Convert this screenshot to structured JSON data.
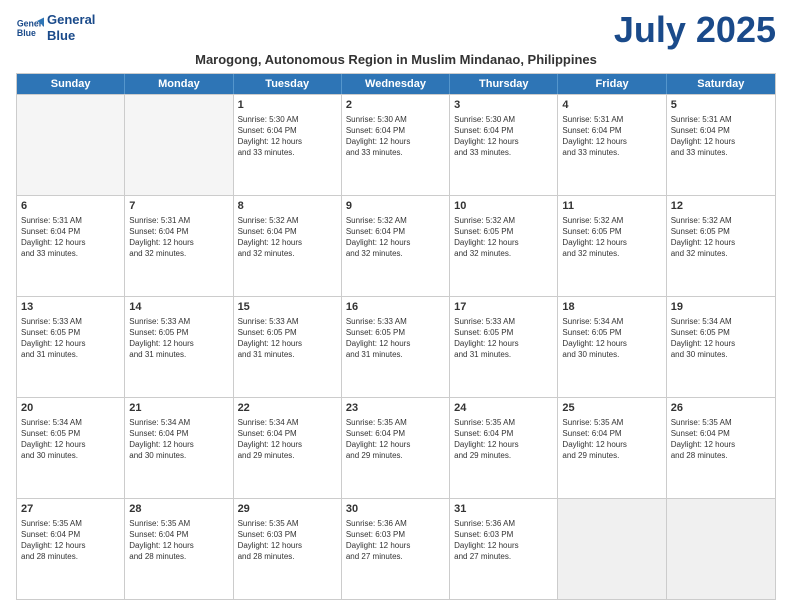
{
  "header": {
    "logo_line1": "General",
    "logo_line2": "Blue",
    "month": "July 2025",
    "subtitle": "Marogong, Autonomous Region in Muslim Mindanao, Philippines"
  },
  "weekdays": [
    "Sunday",
    "Monday",
    "Tuesday",
    "Wednesday",
    "Thursday",
    "Friday",
    "Saturday"
  ],
  "rows": [
    [
      {
        "day": "",
        "info": "",
        "empty": true
      },
      {
        "day": "",
        "info": "",
        "empty": true
      },
      {
        "day": "1",
        "info": "Sunrise: 5:30 AM\nSunset: 6:04 PM\nDaylight: 12 hours\nand 33 minutes."
      },
      {
        "day": "2",
        "info": "Sunrise: 5:30 AM\nSunset: 6:04 PM\nDaylight: 12 hours\nand 33 minutes."
      },
      {
        "day": "3",
        "info": "Sunrise: 5:30 AM\nSunset: 6:04 PM\nDaylight: 12 hours\nand 33 minutes."
      },
      {
        "day": "4",
        "info": "Sunrise: 5:31 AM\nSunset: 6:04 PM\nDaylight: 12 hours\nand 33 minutes."
      },
      {
        "day": "5",
        "info": "Sunrise: 5:31 AM\nSunset: 6:04 PM\nDaylight: 12 hours\nand 33 minutes."
      }
    ],
    [
      {
        "day": "6",
        "info": "Sunrise: 5:31 AM\nSunset: 6:04 PM\nDaylight: 12 hours\nand 33 minutes."
      },
      {
        "day": "7",
        "info": "Sunrise: 5:31 AM\nSunset: 6:04 PM\nDaylight: 12 hours\nand 32 minutes."
      },
      {
        "day": "8",
        "info": "Sunrise: 5:32 AM\nSunset: 6:04 PM\nDaylight: 12 hours\nand 32 minutes."
      },
      {
        "day": "9",
        "info": "Sunrise: 5:32 AM\nSunset: 6:04 PM\nDaylight: 12 hours\nand 32 minutes."
      },
      {
        "day": "10",
        "info": "Sunrise: 5:32 AM\nSunset: 6:05 PM\nDaylight: 12 hours\nand 32 minutes."
      },
      {
        "day": "11",
        "info": "Sunrise: 5:32 AM\nSunset: 6:05 PM\nDaylight: 12 hours\nand 32 minutes."
      },
      {
        "day": "12",
        "info": "Sunrise: 5:32 AM\nSunset: 6:05 PM\nDaylight: 12 hours\nand 32 minutes."
      }
    ],
    [
      {
        "day": "13",
        "info": "Sunrise: 5:33 AM\nSunset: 6:05 PM\nDaylight: 12 hours\nand 31 minutes."
      },
      {
        "day": "14",
        "info": "Sunrise: 5:33 AM\nSunset: 6:05 PM\nDaylight: 12 hours\nand 31 minutes."
      },
      {
        "day": "15",
        "info": "Sunrise: 5:33 AM\nSunset: 6:05 PM\nDaylight: 12 hours\nand 31 minutes."
      },
      {
        "day": "16",
        "info": "Sunrise: 5:33 AM\nSunset: 6:05 PM\nDaylight: 12 hours\nand 31 minutes."
      },
      {
        "day": "17",
        "info": "Sunrise: 5:33 AM\nSunset: 6:05 PM\nDaylight: 12 hours\nand 31 minutes."
      },
      {
        "day": "18",
        "info": "Sunrise: 5:34 AM\nSunset: 6:05 PM\nDaylight: 12 hours\nand 30 minutes."
      },
      {
        "day": "19",
        "info": "Sunrise: 5:34 AM\nSunset: 6:05 PM\nDaylight: 12 hours\nand 30 minutes."
      }
    ],
    [
      {
        "day": "20",
        "info": "Sunrise: 5:34 AM\nSunset: 6:05 PM\nDaylight: 12 hours\nand 30 minutes."
      },
      {
        "day": "21",
        "info": "Sunrise: 5:34 AM\nSunset: 6:04 PM\nDaylight: 12 hours\nand 30 minutes."
      },
      {
        "day": "22",
        "info": "Sunrise: 5:34 AM\nSunset: 6:04 PM\nDaylight: 12 hours\nand 29 minutes."
      },
      {
        "day": "23",
        "info": "Sunrise: 5:35 AM\nSunset: 6:04 PM\nDaylight: 12 hours\nand 29 minutes."
      },
      {
        "day": "24",
        "info": "Sunrise: 5:35 AM\nSunset: 6:04 PM\nDaylight: 12 hours\nand 29 minutes."
      },
      {
        "day": "25",
        "info": "Sunrise: 5:35 AM\nSunset: 6:04 PM\nDaylight: 12 hours\nand 29 minutes."
      },
      {
        "day": "26",
        "info": "Sunrise: 5:35 AM\nSunset: 6:04 PM\nDaylight: 12 hours\nand 28 minutes."
      }
    ],
    [
      {
        "day": "27",
        "info": "Sunrise: 5:35 AM\nSunset: 6:04 PM\nDaylight: 12 hours\nand 28 minutes."
      },
      {
        "day": "28",
        "info": "Sunrise: 5:35 AM\nSunset: 6:04 PM\nDaylight: 12 hours\nand 28 minutes."
      },
      {
        "day": "29",
        "info": "Sunrise: 5:35 AM\nSunset: 6:03 PM\nDaylight: 12 hours\nand 28 minutes."
      },
      {
        "day": "30",
        "info": "Sunrise: 5:36 AM\nSunset: 6:03 PM\nDaylight: 12 hours\nand 27 minutes."
      },
      {
        "day": "31",
        "info": "Sunrise: 5:36 AM\nSunset: 6:03 PM\nDaylight: 12 hours\nand 27 minutes."
      },
      {
        "day": "",
        "info": "",
        "empty": true,
        "shaded": true
      },
      {
        "day": "",
        "info": "",
        "empty": true,
        "shaded": true
      }
    ]
  ]
}
